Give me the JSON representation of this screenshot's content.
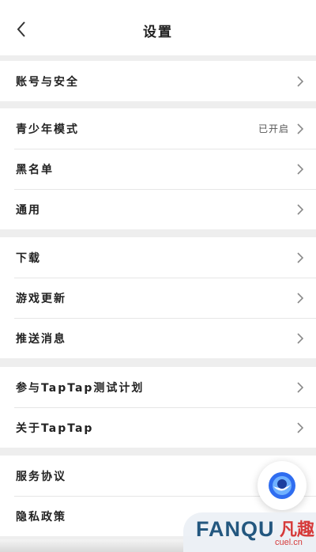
{
  "header": {
    "title": "设置"
  },
  "groups": [
    {
      "items": [
        {
          "label": "账号与安全"
        }
      ]
    },
    {
      "items": [
        {
          "label": "青少年模式",
          "value": "已开启"
        },
        {
          "label": "黑名单"
        },
        {
          "label": "通用"
        }
      ]
    },
    {
      "items": [
        {
          "label": "下载"
        },
        {
          "label": "游戏更新"
        },
        {
          "label": "推送消息"
        }
      ]
    },
    {
      "items": [
        {
          "label": "参与TapTap测试计划"
        },
        {
          "label": "关于TapTap"
        }
      ]
    },
    {
      "items": [
        {
          "label": "服务协议"
        },
        {
          "label": "隐私政策"
        }
      ]
    }
  ],
  "watermark": {
    "brand": "FANQU",
    "cn": "凡趣",
    "domain": "cuel.cn"
  },
  "colors": {
    "background": "#eeeeee",
    "surface": "#ffffff",
    "fab_accent": "#2f6df0",
    "watermark": "#23577f"
  }
}
